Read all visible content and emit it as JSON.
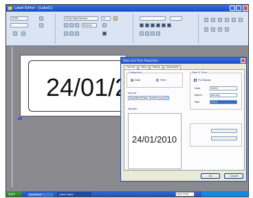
{
  "window": {
    "title": "Label Editor - [Label1]"
  },
  "ribbon": {
    "zoom_value": "100%",
    "font_name": "Times New Roman",
    "font_size": "12",
    "style_value": "Normal"
  },
  "canvas": {
    "label_text": "24/01/2"
  },
  "dialog": {
    "title": "Date and Time Properties",
    "tabs": [
      "Format",
      "Font",
      "Frame",
      "Advanced"
    ],
    "categories_label": "Categories",
    "category_options": [
      "Date",
      "Time"
    ],
    "format_label": "Format",
    "format_value": "Day/Month/Year (dd/mm/yyyy)",
    "sample_label": "Sample",
    "sample_text": "24/01/2010",
    "date_time_label": "Date & Time",
    "fixed_label": "Fix Display",
    "field_labels": [
      "Date",
      "Month",
      "Year"
    ],
    "field_values": [
      "24/01",
      "January",
      "2010"
    ],
    "ok_label": "OK",
    "cancel_label": "Cancel"
  },
  "taskbar": {
    "start_label": "start",
    "items": [
      "Document",
      "Label Editor"
    ],
    "status_text": "Label 24/01"
  },
  "colors": {
    "accent": "#1a4cc4",
    "dialog_bg": "#ece9d8",
    "selection": "#316ac5"
  },
  "icons": [
    "app-icon",
    "minimize-icon",
    "maximize-icon",
    "close-icon",
    "dropdown-arrow-icon"
  ]
}
